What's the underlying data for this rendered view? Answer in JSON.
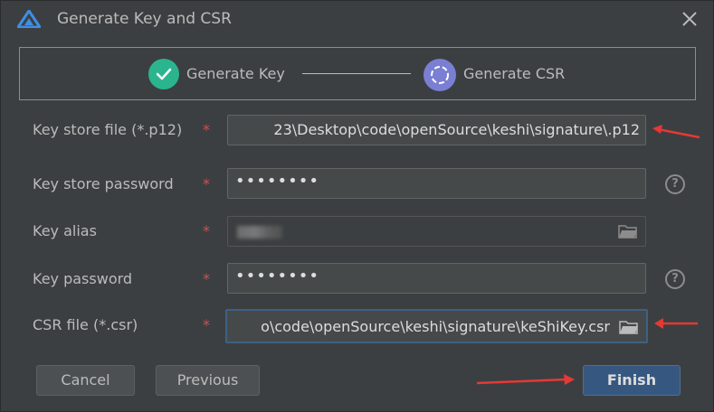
{
  "window": {
    "title": "Generate Key and CSR",
    "logo_icon": "deveco-logo-icon",
    "close_icon": "close-icon"
  },
  "stepper": {
    "steps": [
      {
        "label": "Generate Key",
        "status": "done",
        "icon": "check-icon",
        "color": "#2bb58f"
      },
      {
        "label": "Generate CSR",
        "status": "current",
        "icon": "progress-ring-icon",
        "color": "#7a7fd4"
      }
    ]
  },
  "form": {
    "required_mark": "*",
    "key_store_file": {
      "label": "Key store file (*.p12)",
      "value": "23\\Desktop\\code\\openSource\\keshi\\signature\\.p12"
    },
    "key_store_password": {
      "label": "Key store password",
      "value": "••••••••",
      "help_icon": "?"
    },
    "key_alias": {
      "label": "Key alias",
      "value_obscured": true,
      "folder_icon": "folder-icon"
    },
    "key_password": {
      "label": "Key password",
      "value": "••••••••",
      "help_icon": "?"
    },
    "csr_file": {
      "label": "CSR file (*.csr)",
      "value": "o\\code\\openSource\\keshi\\signature\\keShiKey.csr",
      "folder_icon": "folder-icon"
    }
  },
  "buttons": {
    "cancel": "Cancel",
    "previous": "Previous",
    "finish": "Finish"
  },
  "colors": {
    "background": "#3c3f41",
    "annotation_arrow": "#e53935",
    "primary_button": "#365880",
    "required": "#c75450"
  }
}
